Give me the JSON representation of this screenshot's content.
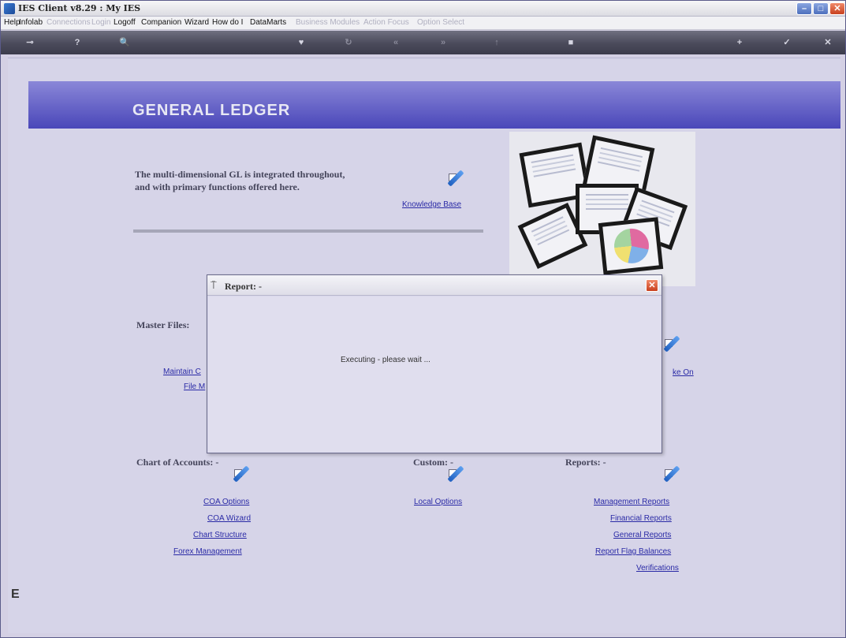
{
  "window": {
    "title": "IES Client v8.29 : My IES",
    "buttons": {
      "minimize": "–",
      "maximize": "□",
      "close": "✕"
    }
  },
  "menu": {
    "items": [
      {
        "label": "Help",
        "enabled": true
      },
      {
        "label": "Infolab",
        "enabled": true
      },
      {
        "label": "Connections",
        "enabled": false
      },
      {
        "label": "Login",
        "enabled": false
      },
      {
        "label": "Logoff",
        "enabled": true
      },
      {
        "label": "Companion",
        "enabled": true
      },
      {
        "label": "Wizard",
        "enabled": true
      },
      {
        "label": "How do I",
        "enabled": true
      },
      {
        "label": "DataMarts",
        "enabled": true
      },
      {
        "label": "Business Modules",
        "enabled": false
      },
      {
        "label": "Action Focus",
        "enabled": false
      },
      {
        "label": "Option Select",
        "enabled": false
      }
    ]
  },
  "toolbar": {
    "icons": [
      "key-icon",
      "help-icon",
      "search-icon",
      "heart-icon",
      "refresh-icon",
      "back-icon",
      "forward-icon",
      "up-icon",
      "stop-icon",
      "plus-icon",
      "check-icon",
      "close-icon"
    ],
    "glyphs": [
      "⊸",
      "?",
      "🔍",
      "♥",
      "↻",
      "«",
      "»",
      "↑",
      "■",
      "+",
      "✓",
      "✕"
    ]
  },
  "page": {
    "title": "GENERAL  LEDGER",
    "intro": "The multi-dimensional GL is integrated throughout, and with primary functions offered here.",
    "knowledge_base": "Knowledge Base"
  },
  "sections": {
    "master_files": {
      "label": "Master Files:",
      "links": [
        "Maintain C",
        "File M"
      ]
    },
    "take_on": {
      "link": "ke On"
    },
    "chart_of_accounts": {
      "label": "Chart of Accounts: -",
      "links": [
        "COA Options",
        "COA Wizard",
        "Chart Structure",
        "Forex Management"
      ]
    },
    "custom": {
      "label": "Custom: -",
      "links": [
        "Local Options"
      ]
    },
    "reports": {
      "label": "Reports: -",
      "links": [
        "Management Reports",
        "Financial Reports",
        "General Reports",
        "Report Flag Balances",
        "Verifications"
      ]
    }
  },
  "dialog": {
    "title": "Report: -",
    "message": "Executing - please wait ...",
    "close": "✕"
  },
  "side_letter": "E",
  "colors": {
    "banner": "#4a47b9",
    "background": "#d6d4e8",
    "link": "#2a2aa6"
  }
}
